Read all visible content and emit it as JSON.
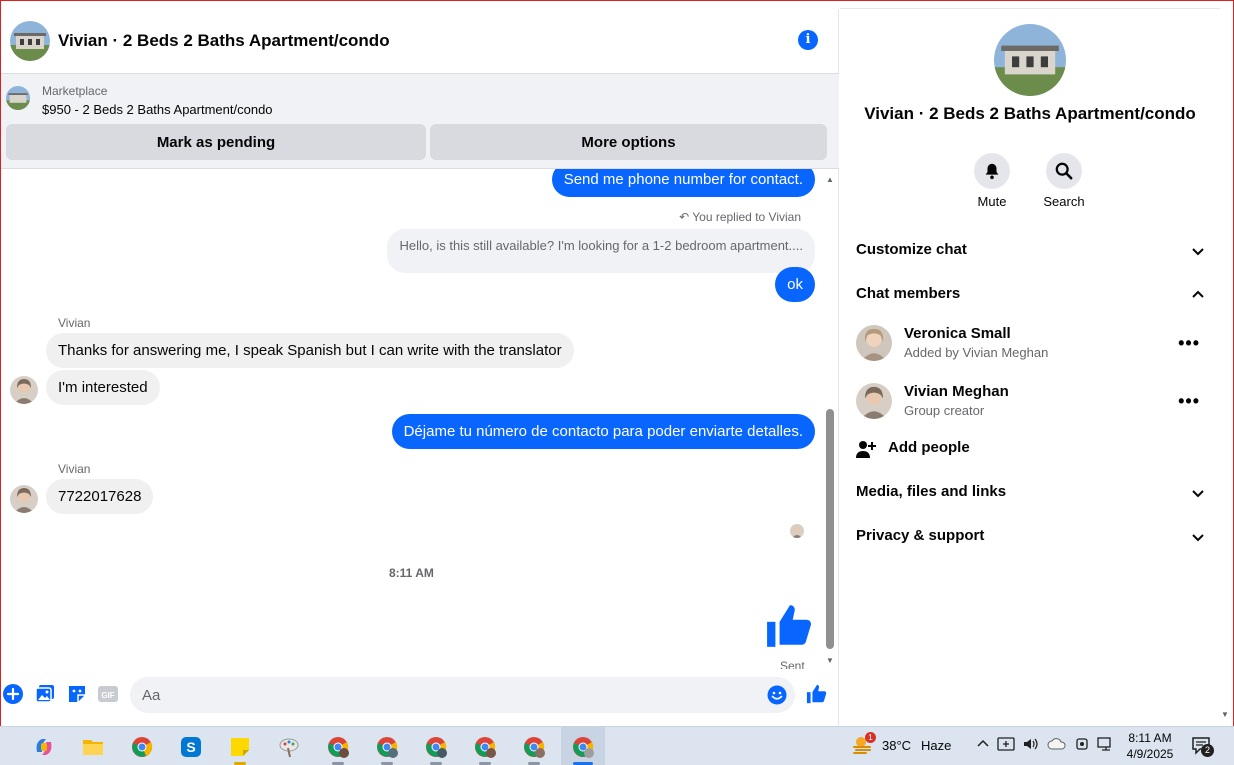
{
  "chat": {
    "title": "Vivian · 2 Beds 2 Baths Apartment/condo",
    "marketplace": {
      "label": "Marketplace",
      "item": "$950 - 2 Beds 2 Baths Apartment/condo",
      "mark_pending": "Mark as pending",
      "more_options": "More options"
    },
    "messages": {
      "m1": "Send me phone number for contact.",
      "replied_label": "You replied to Vivian",
      "quoted": "Hello, is this still available? I'm looking for a 1-2 bedroom apartment....",
      "m2": "ok",
      "sender1": "Vivian",
      "m3": "Thanks for answering me, I speak Spanish but I can write with the translator",
      "m4": "I'm interested",
      "m5": "Déjame tu número de contacto para poder enviarte detalles.",
      "sender2": "Vivian",
      "m6": "7722017628",
      "timestamp": "8:11 AM",
      "sent_label": "Sent"
    },
    "composer": {
      "placeholder": "Aa"
    }
  },
  "panel": {
    "title": "Vivian · 2 Beds 2 Baths Apartment/condo",
    "mute": "Mute",
    "search": "Search",
    "customize": "Customize chat",
    "members_heading": "Chat members",
    "members": [
      {
        "name": "Veronica Small",
        "sub": "Added by Vivian Meghan"
      },
      {
        "name": "Vivian Meghan",
        "sub": "Group creator"
      }
    ],
    "add_people": "Add people",
    "media": "Media, files and links",
    "privacy": "Privacy & support"
  },
  "taskbar": {
    "weather_badge": "1",
    "temp": "38°C",
    "condition": "Haze",
    "time": "8:11 AM",
    "date": "4/9/2025",
    "notif_count": "2"
  },
  "colors": {
    "accent": "#0866ff",
    "bubble_in": "#f0f0f0",
    "marketplace_bg": "#f0f2f5"
  }
}
